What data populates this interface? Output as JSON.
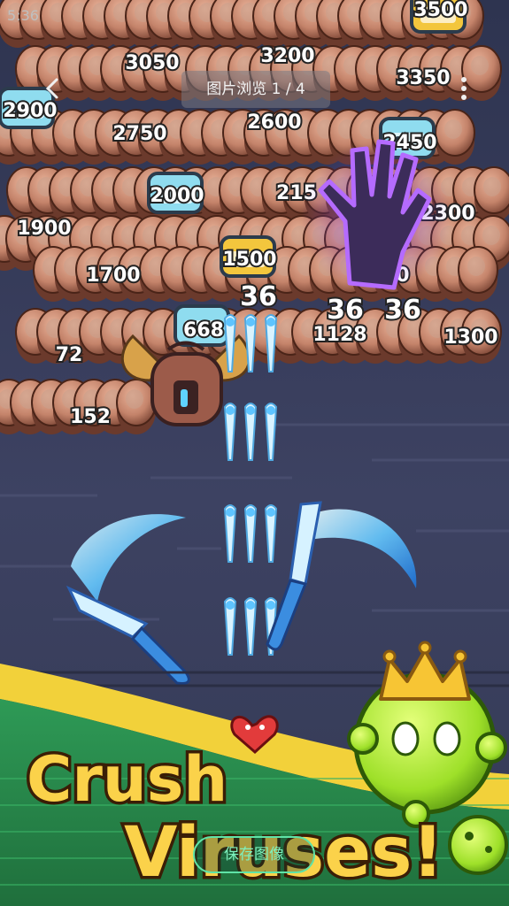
{
  "viewer": {
    "title": "图片浏览 1 / 4",
    "save_label": "保存图像",
    "status_time": "5:36"
  },
  "game": {
    "headline_line1": "Crush",
    "headline_line2": "Viruses!",
    "damage_popups": [
      "36",
      "36",
      "36"
    ],
    "segment_numbers": [
      "3500",
      "3050",
      "3200",
      "3350",
      "2900",
      "2750",
      "2600",
      "2450",
      "2000",
      "215",
      "2300",
      "1900",
      "1700",
      "1500",
      "1400",
      "668",
      "1128",
      "1300",
      "72",
      "152"
    ]
  }
}
